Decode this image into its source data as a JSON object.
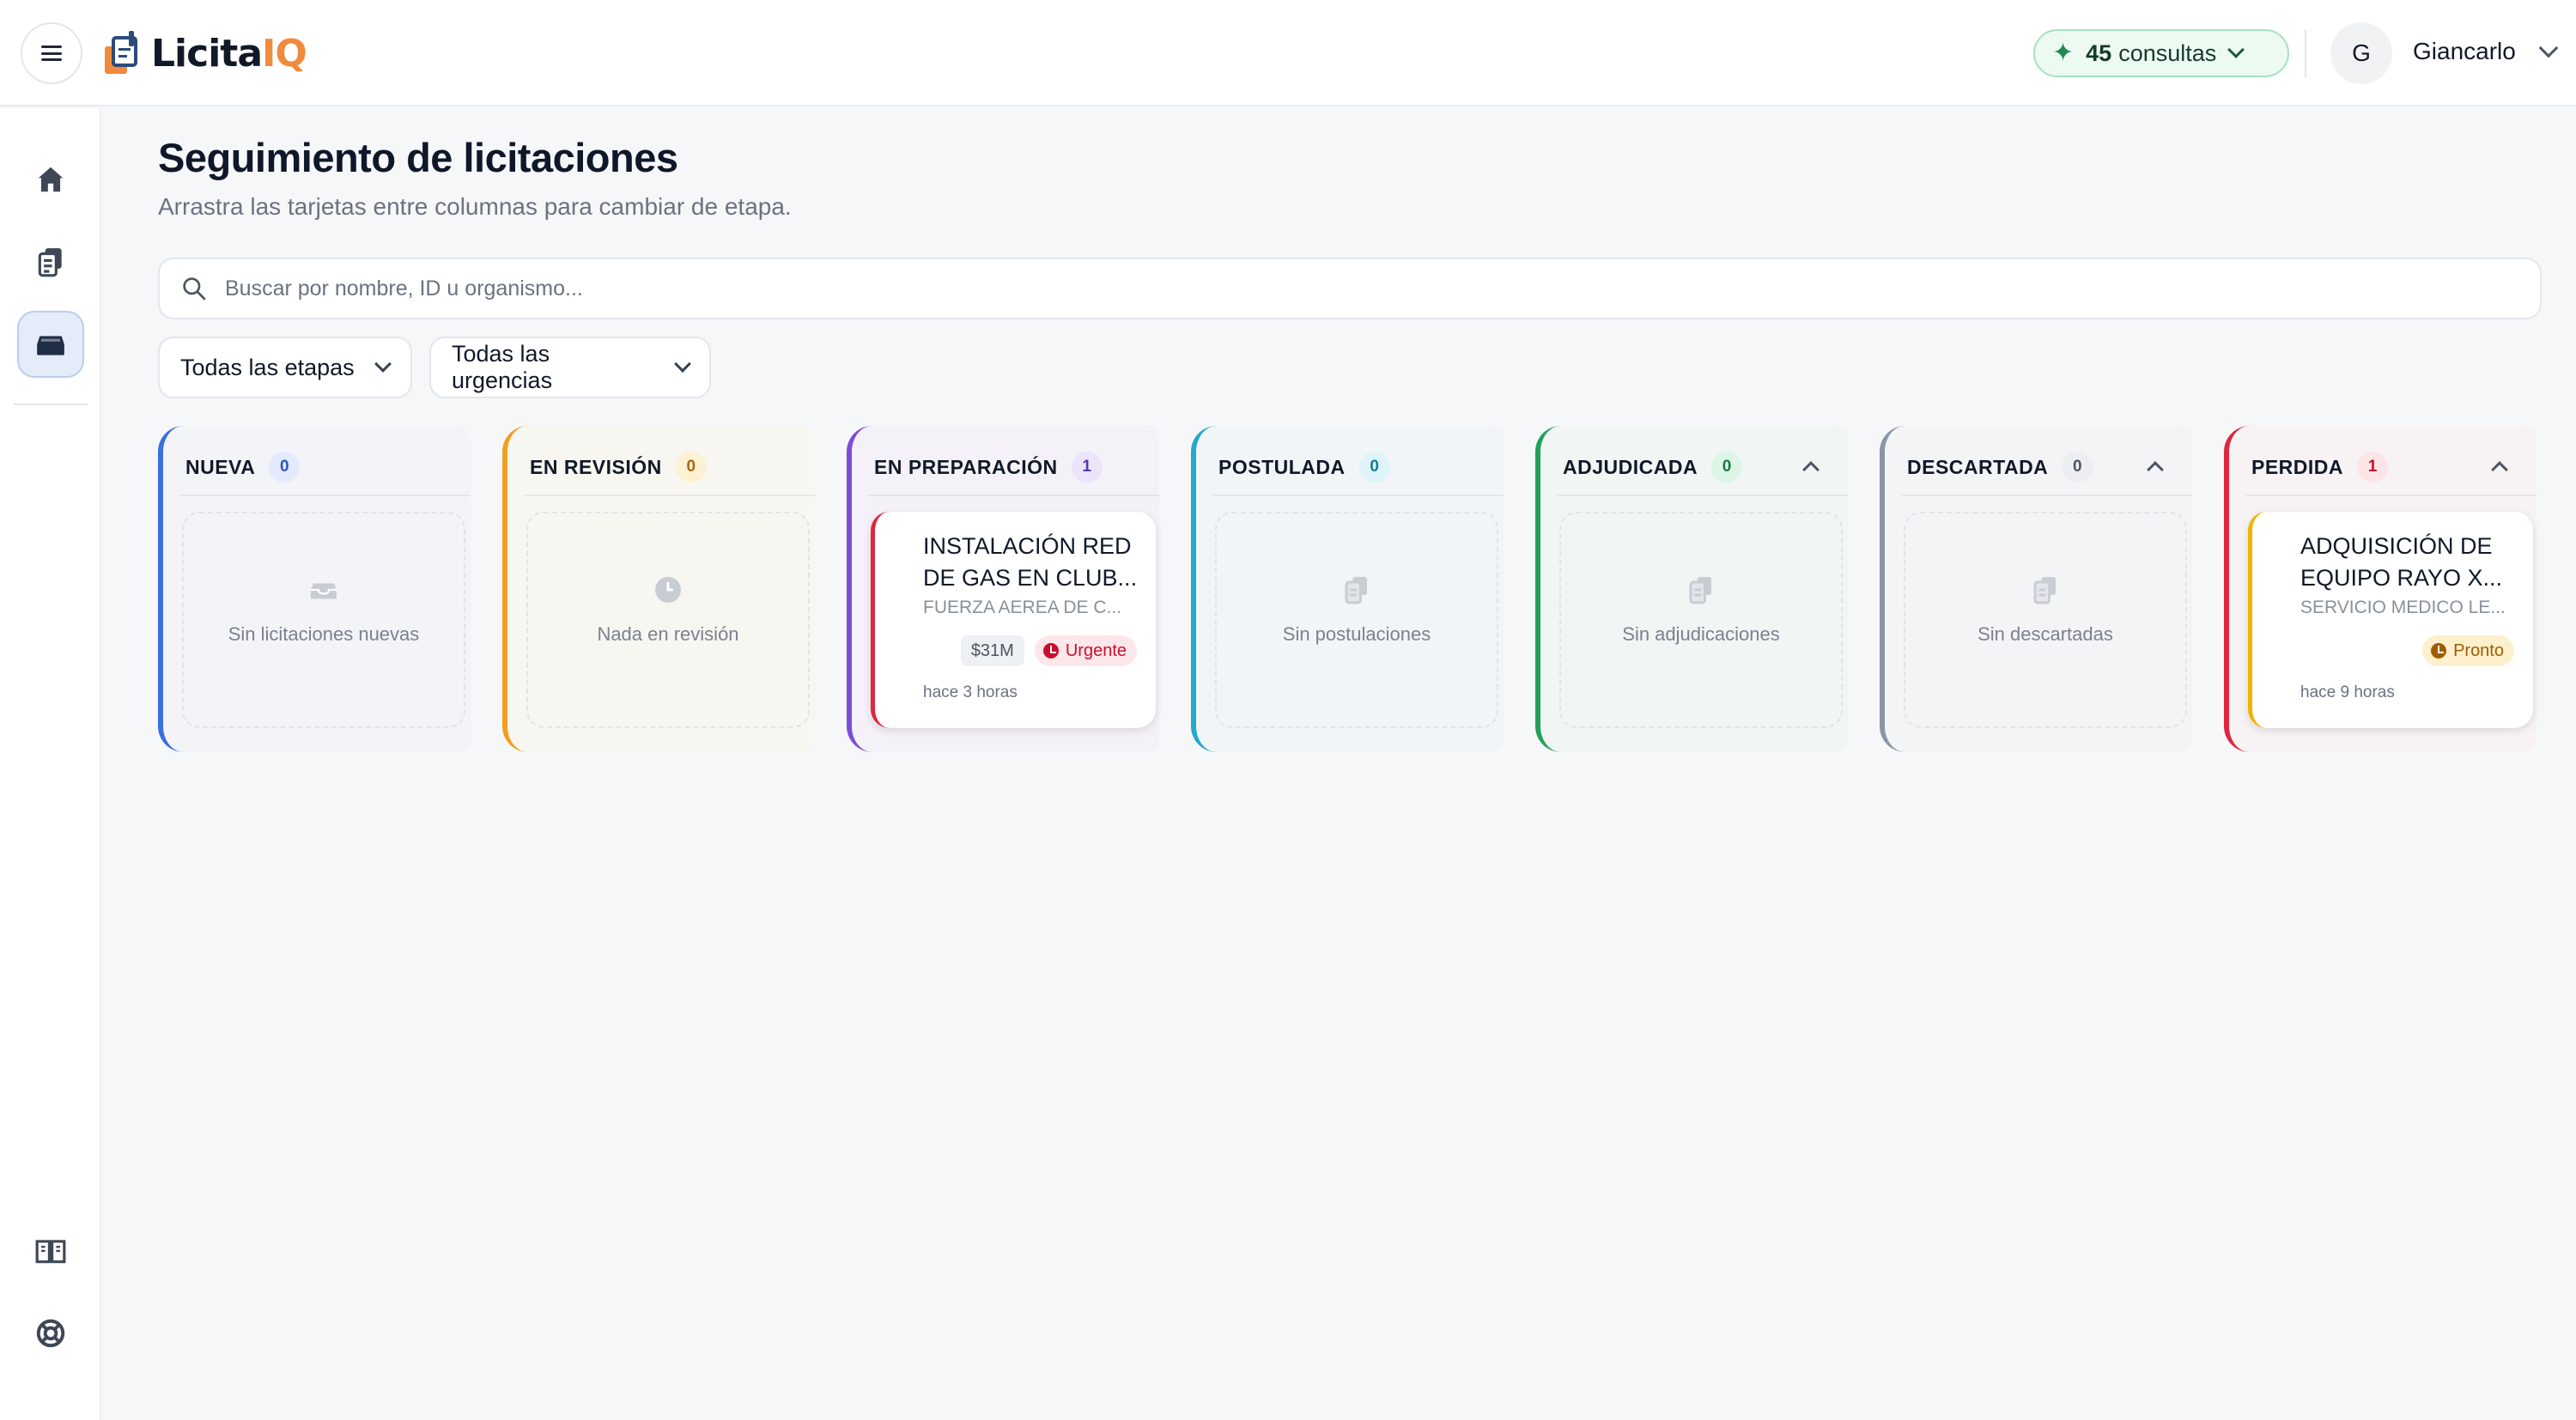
{
  "app": {
    "logo_text_a": "Licita",
    "logo_text_b": "IQ"
  },
  "header": {
    "credits_count": "45",
    "credits_label": "consultas",
    "user_initial": "G",
    "user_name": "Giancarlo"
  },
  "sidebar": {
    "items": [
      {
        "icon": "home-icon"
      },
      {
        "icon": "documents-icon"
      },
      {
        "icon": "inbox-icon",
        "active": true
      }
    ],
    "bottom_items": [
      {
        "icon": "book-icon"
      },
      {
        "icon": "help-lifebuoy-icon"
      }
    ]
  },
  "main": {
    "title": "Seguimiento de licitaciones",
    "subtitle": "Arrastra las tarjetas entre columnas para cambiar de etapa.",
    "search_placeholder": "Buscar por nombre, ID u organismo...",
    "filters": {
      "stage": "Todas las etapas",
      "urgency": "Todas las urgencias"
    }
  },
  "columns": [
    {
      "name": "NUEVA",
      "count": "0",
      "color": "#3b6fe0",
      "bg": "#f2f4f8",
      "badge_bg": "#e2eafb",
      "badge_fg": "#2f55b5",
      "empty_text": "Sin licitaciones nuevas",
      "empty_icon": "inbox-icon",
      "collapsible": false
    },
    {
      "name": "EN REVISIÓN",
      "count": "0",
      "color": "#f0a020",
      "bg": "#f7f6f0",
      "badge_bg": "#fdf1d3",
      "badge_fg": "#a86a06",
      "empty_text": "Nada en revisión",
      "empty_icon": "clock-icon",
      "collapsible": false
    },
    {
      "name": "EN PREPARACIÓN",
      "count": "1",
      "color": "#7c4ddb",
      "bg": "#f4f2f8",
      "badge_bg": "#ece4fb",
      "badge_fg": "#5b34b0",
      "collapsible": false,
      "card": {
        "title": "INSTALACIÓN RED DE GAS EN CLUB...",
        "org": "FUERZA AEREA DE C...",
        "amount": "$31M",
        "urgency": "Urgente",
        "urgency_bg": "#fde7ea",
        "urgency_fg": "#c8102e",
        "time": "hace 3 horas",
        "accent": "#e0263f"
      }
    },
    {
      "name": "POSTULADA",
      "count": "0",
      "color": "#23a9c9",
      "bg": "#f1f5f7",
      "badge_bg": "#dff4f9",
      "badge_fg": "#157a93",
      "empty_text": "Sin postulaciones",
      "empty_icon": "documents-icon",
      "collapsible": false
    },
    {
      "name": "ADJUDICADA",
      "count": "0",
      "color": "#22a05a",
      "bg": "#f1f5f3",
      "badge_bg": "#dcf5e7",
      "badge_fg": "#187a43",
      "empty_text": "Sin adjudicaciones",
      "empty_icon": "documents-icon",
      "collapsible": true
    },
    {
      "name": "DESCARTADA",
      "count": "0",
      "color": "#8b95a8",
      "bg": "#f3f4f6",
      "badge_bg": "#eceef2",
      "badge_fg": "#4b5563",
      "empty_text": "Sin descartadas",
      "empty_icon": "documents-icon",
      "collapsible": true
    },
    {
      "name": "PERDIDA",
      "count": "1",
      "color": "#e0263f",
      "bg": "#f7f3f4",
      "badge_bg": "#fde4e7",
      "badge_fg": "#c8102e",
      "collapsible": true,
      "card": {
        "title": "ADQUISICIÓN DE EQUIPO RAYO X...",
        "org": "SERVICIO MEDICO LE...",
        "amount": "",
        "urgency": "Pronto",
        "urgency_bg": "#fdf0cc",
        "urgency_fg": "#a15c00",
        "time": "hace 9 horas",
        "accent": "#f0b400"
      }
    }
  ]
}
